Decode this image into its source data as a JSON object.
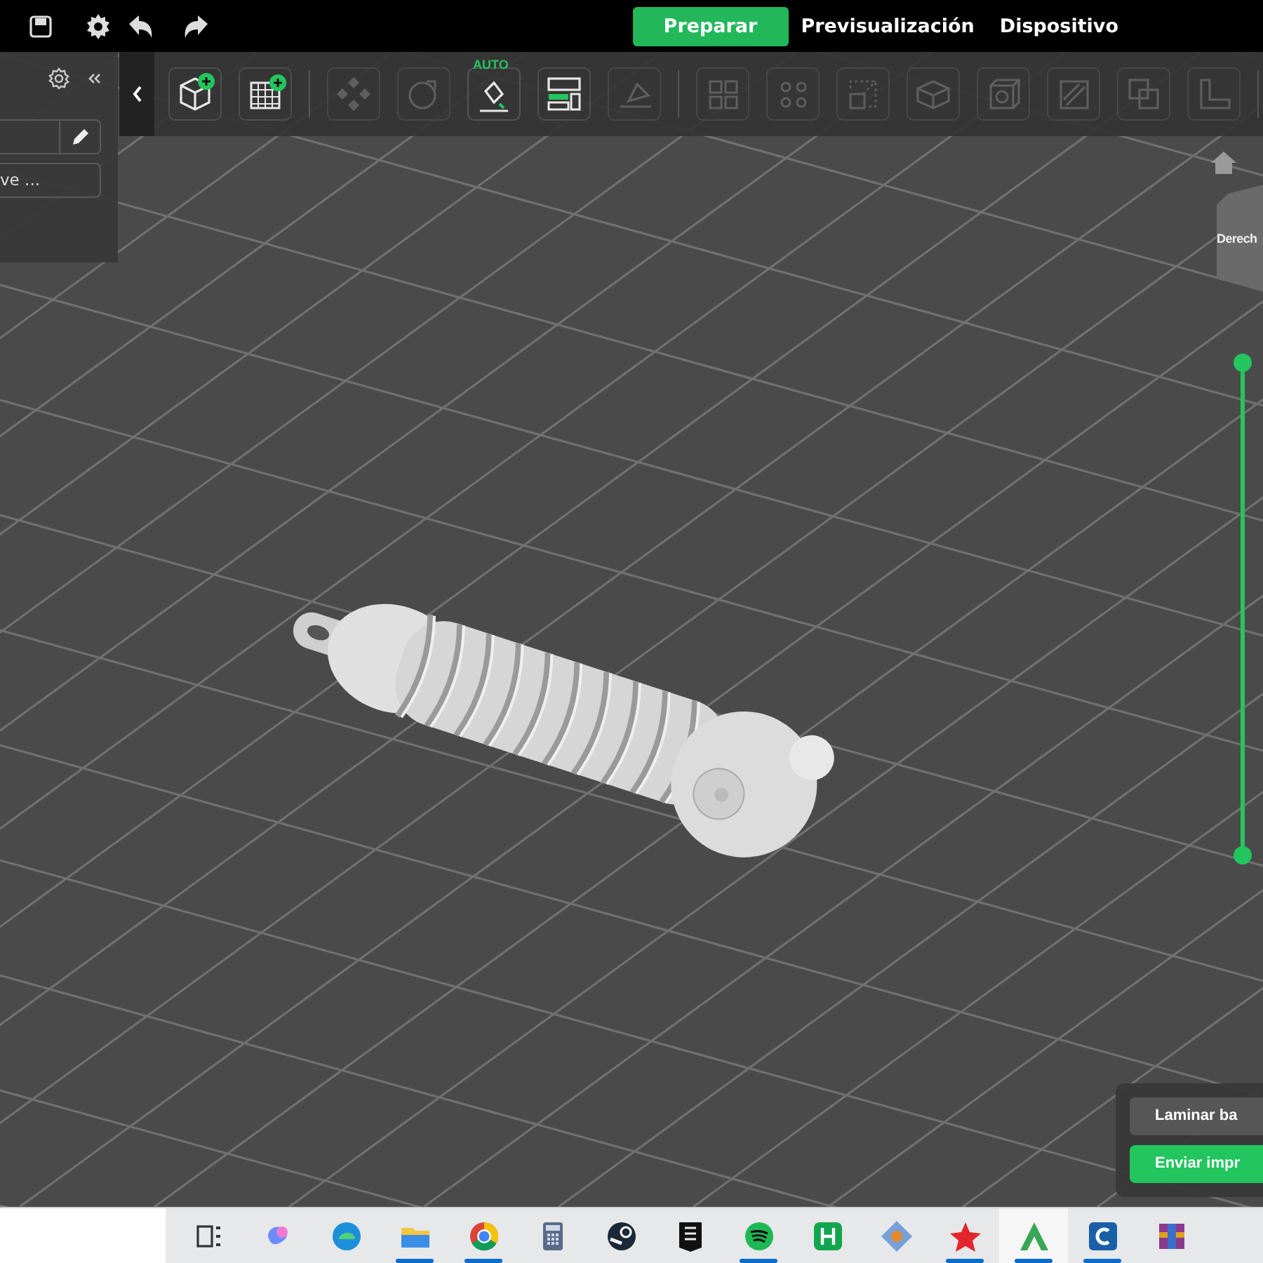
{
  "topbar": {
    "tabs": [
      {
        "label": "Preparar",
        "selected": true
      },
      {
        "label": "Previsualización",
        "selected": false
      },
      {
        "label": "Dispositivo",
        "selected": false
      }
    ]
  },
  "left_panel": {
    "field_value": "ve ..."
  },
  "toolbar": {
    "auto_label": "AUTO",
    "tools": [
      {
        "kind": "add-model",
        "disabled": false
      },
      {
        "kind": "add-plate",
        "disabled": false
      },
      {
        "kind": "separator"
      },
      {
        "kind": "arrange",
        "disabled": true
      },
      {
        "kind": "orient",
        "disabled": true
      },
      {
        "kind": "auto-orient",
        "disabled": false
      },
      {
        "kind": "layout",
        "disabled": false
      },
      {
        "kind": "lay-face",
        "disabled": true
      },
      {
        "kind": "separator"
      },
      {
        "kind": "split-objects",
        "disabled": true
      },
      {
        "kind": "split-parts",
        "disabled": true
      },
      {
        "kind": "scale",
        "disabled": true
      },
      {
        "kind": "box",
        "disabled": true
      },
      {
        "kind": "cube",
        "disabled": true
      },
      {
        "kind": "slash",
        "disabled": true
      },
      {
        "kind": "overlap",
        "disabled": true
      },
      {
        "kind": "ruler",
        "disabled": true
      },
      {
        "kind": "separator"
      }
    ]
  },
  "view_cube": {
    "face_label": "Derech"
  },
  "layer_slider": {
    "level": 1
  },
  "slice_panel": {
    "buttons": [
      {
        "label": "Laminar ba",
        "kind": "secondary"
      },
      {
        "label": "Enviar impr",
        "kind": "primary"
      }
    ]
  },
  "taskbar": {
    "apps": [
      {
        "kind": "task-view",
        "running": false,
        "selected": false
      },
      {
        "kind": "swirl",
        "running": false,
        "selected": false
      },
      {
        "kind": "wave",
        "running": false,
        "selected": false
      },
      {
        "kind": "folder",
        "running": true,
        "selected": false
      },
      {
        "kind": "ring",
        "running": true,
        "selected": false
      },
      {
        "kind": "calculator",
        "running": false,
        "selected": false
      },
      {
        "kind": "gear-disc",
        "running": false,
        "selected": false
      },
      {
        "kind": "shield",
        "running": false,
        "selected": false
      },
      {
        "kind": "bars",
        "running": true,
        "selected": false
      },
      {
        "kind": "square",
        "running": false,
        "selected": false
      },
      {
        "kind": "diamond",
        "running": false,
        "selected": false
      },
      {
        "kind": "star",
        "running": true,
        "selected": false
      },
      {
        "kind": "arrow",
        "running": true,
        "selected": true
      },
      {
        "kind": "c-square",
        "running": true,
        "selected": false
      },
      {
        "kind": "books",
        "running": false,
        "selected": false
      }
    ]
  }
}
